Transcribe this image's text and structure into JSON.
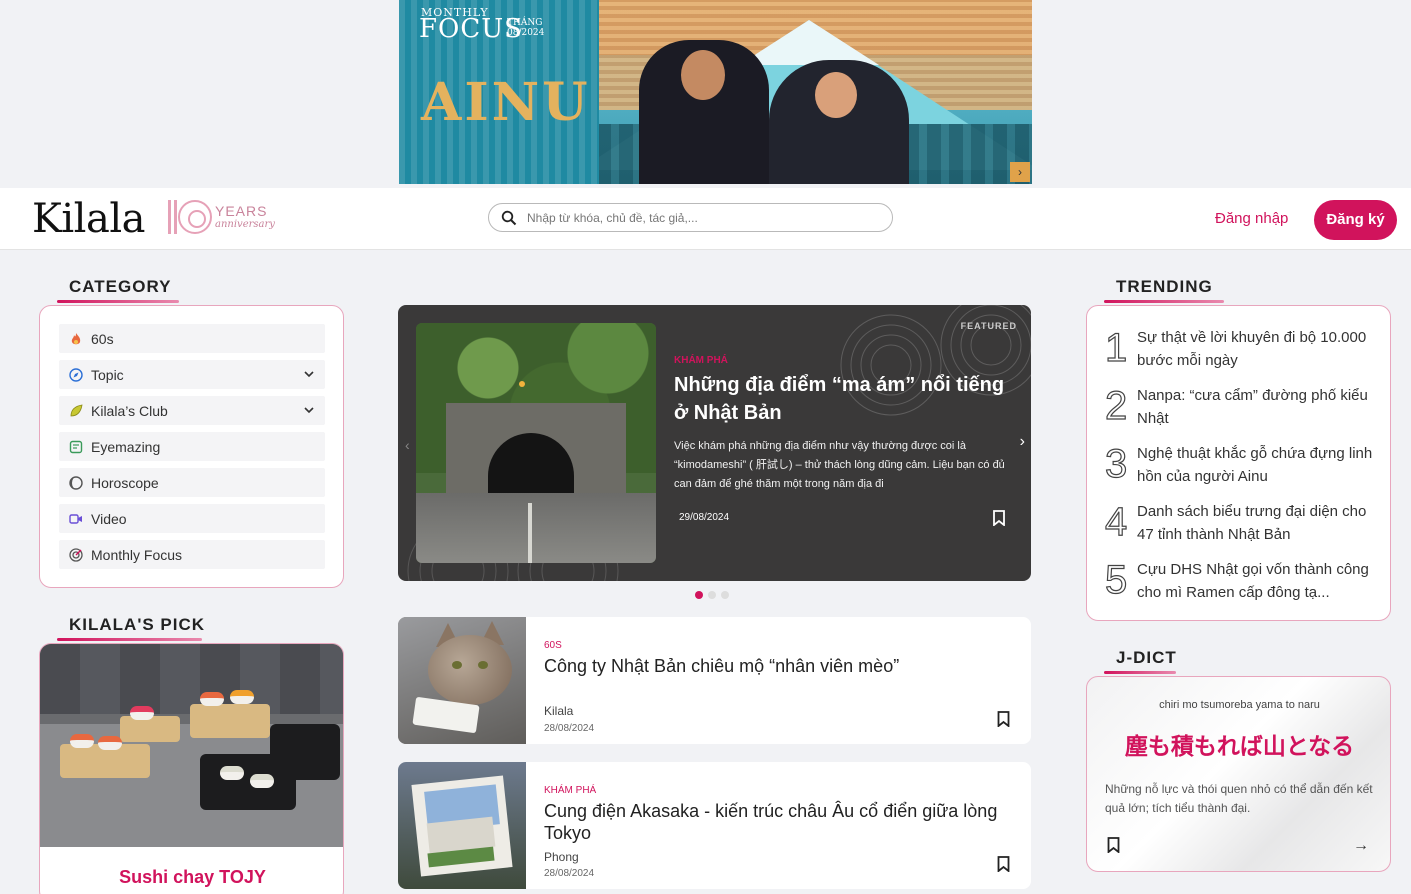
{
  "banner": {
    "monthly": "MONTHLY",
    "focus": "FOCUS",
    "thang": "THÁNG",
    "date": "08/2024",
    "title": "AINU",
    "next_icon": "chevron-right-icon"
  },
  "header": {
    "logo": "Kilala",
    "anniversary_years": "YEARS",
    "anniversary_text": "anniversary",
    "search_placeholder": "Nhập từ khóa, chủ đề, tác giả,...",
    "login_label": "Đăng nhập",
    "signup_label": "Đăng ký"
  },
  "category": {
    "title": "CATEGORY",
    "items": [
      {
        "label": "60s",
        "icon": "fire-icon",
        "expandable": false
      },
      {
        "label": "Topic",
        "icon": "compass-icon",
        "expandable": true
      },
      {
        "label": "Kilala’s Club",
        "icon": "leaf-icon",
        "expandable": true
      },
      {
        "label": "Eyemazing",
        "icon": "note-icon",
        "expandable": false
      },
      {
        "label": "Horoscope",
        "icon": "moon-icon",
        "expandable": false
      },
      {
        "label": "Video",
        "icon": "video-icon",
        "expandable": false
      },
      {
        "label": "Monthly Focus",
        "icon": "target-icon",
        "expandable": false
      }
    ]
  },
  "pick": {
    "title": "KILALA'S PICK",
    "name": "Sushi chay TOJY"
  },
  "featured": {
    "tag": "FEATURED",
    "category": "KHÁM PHÁ",
    "title": "Những địa điểm “ma ám” nổi tiếng ở Nhật Bản",
    "description": "Việc khám phá những địa điểm như vậy thường được coi là “kimodameshi” ( 肝試し) – thử thách lòng dũng cảm. Liệu bạn có đủ can đảm để ghé thăm một trong năm địa đi",
    "date": "29/08/2024",
    "slide_index": 0,
    "slide_count": 3
  },
  "articles": [
    {
      "category": "60S",
      "title": "Công ty Nhật Bản chiêu mộ “nhân viên mèo”",
      "author": "Kilala",
      "date": "28/08/2024"
    },
    {
      "category": "KHÁM PHÁ",
      "title": "Cung điện Akasaka - kiến trúc châu Âu cổ điển giữa lòng Tokyo",
      "author": "Phong",
      "date": "28/08/2024"
    }
  ],
  "trending": {
    "title": "TRENDING",
    "items": [
      {
        "num": "1",
        "title": "Sự thật về lời khuyên đi bộ 10.000 bước mỗi ngày"
      },
      {
        "num": "2",
        "title": "Nanpa: “cưa cẩm” đường phố kiểu Nhật"
      },
      {
        "num": "3",
        "title": "Nghệ thuật khắc gỗ chứa đựng linh hồn của người Ainu"
      },
      {
        "num": "4",
        "title": "Danh sách biểu trưng đại diện cho 47 tỉnh thành Nhật Bản"
      },
      {
        "num": "5",
        "title": "Cựu DHS Nhật gọi vốn thành công cho mì Ramen cấp đông tạ..."
      }
    ]
  },
  "jdict": {
    "title": "J-DICT",
    "romaji": "chiri mo tsumoreba yama to naru",
    "phrase": "塵も積もれば山となる",
    "meaning": "Những nỗ lực và thói quen nhỏ có thể dẫn đến kết quả lớn; tích tiểu thành đại."
  },
  "colors": {
    "accent": "#d1135c",
    "border_pink": "#e8a6bd",
    "page_bg": "#f1f2f5"
  }
}
